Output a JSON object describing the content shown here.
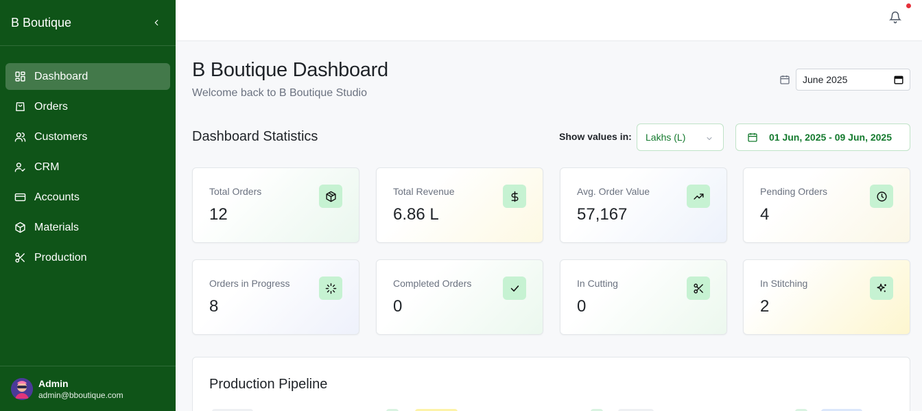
{
  "sidebar": {
    "brand": "B Boutique",
    "items": [
      {
        "label": "Dashboard",
        "icon": "grid-icon",
        "active": true
      },
      {
        "label": "Orders",
        "icon": "shopping-bag-icon"
      },
      {
        "label": "Customers",
        "icon": "users-icon"
      },
      {
        "label": "CRM",
        "icon": "user-check-icon"
      },
      {
        "label": "Accounts",
        "icon": "credit-card-icon"
      },
      {
        "label": "Materials",
        "icon": "package-icon"
      },
      {
        "label": "Production",
        "icon": "scissors-icon"
      }
    ],
    "user": {
      "name": "Admin",
      "email": "admin@bboutique.com"
    }
  },
  "header": {
    "title": "B Boutique Dashboard",
    "subtitle": "Welcome back to B Boutique Studio",
    "month_value": "June 2025"
  },
  "stats": {
    "title": "Dashboard Statistics",
    "show_label": "Show values in:",
    "unit": "Lakhs (L)",
    "date_range": "01 Jun, 2025 - 09 Jun, 2025",
    "cards": [
      {
        "label": "Total Orders",
        "value": "12",
        "icon": "box-icon"
      },
      {
        "label": "Total Revenue",
        "value": "6.86 L",
        "icon": "dollar-icon"
      },
      {
        "label": "Avg. Order Value",
        "value": "57,167",
        "icon": "trending-up-icon"
      },
      {
        "label": "Pending Orders",
        "value": "4",
        "icon": "clock-icon"
      },
      {
        "label": "Orders in Progress",
        "value": "8",
        "icon": "loader-icon"
      },
      {
        "label": "Completed Orders",
        "value": "0",
        "icon": "check-icon"
      },
      {
        "label": "In Cutting",
        "value": "0",
        "icon": "scissors-icon"
      },
      {
        "label": "In Stitching",
        "value": "2",
        "icon": "sparkles-icon"
      }
    ]
  },
  "pipeline": {
    "title": "Production Pipeline"
  },
  "colors": {
    "sidebar": "#0f5418",
    "accent": "#147a2e",
    "icon_bg": "#c6f2d2",
    "notification": "#e5303a"
  }
}
